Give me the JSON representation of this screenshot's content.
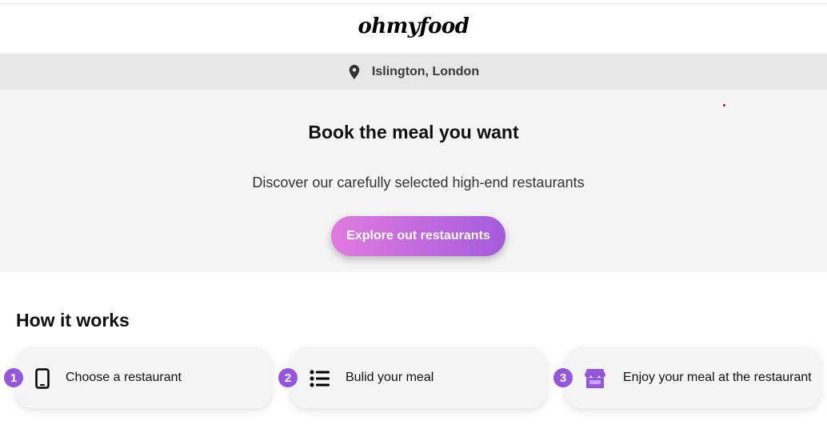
{
  "header": {
    "logo_text": "ohmyfood"
  },
  "location": {
    "icon": "map-pin-icon",
    "text": "Islington, London"
  },
  "hero": {
    "title": "Book the meal you want",
    "subtitle": "Discover our carefully selected high-end restaurants",
    "cta_label": "Explore out restaurants"
  },
  "how_it_works": {
    "title": "How it works",
    "steps": [
      {
        "number": "1",
        "icon": "smartphone-icon",
        "label": "Choose a restaurant"
      },
      {
        "number": "2",
        "icon": "list-icon",
        "label": "Bulid your meal"
      },
      {
        "number": "3",
        "icon": "store-icon",
        "label": "Enjoy your meal at the restaurant"
      }
    ]
  },
  "colors": {
    "accent_purple": "#9356dc",
    "gradient_start": "#e07be0",
    "gradient_end": "#a55bdc",
    "hero_bg": "#f5f5f5",
    "location_bg": "#e7e7e7"
  }
}
